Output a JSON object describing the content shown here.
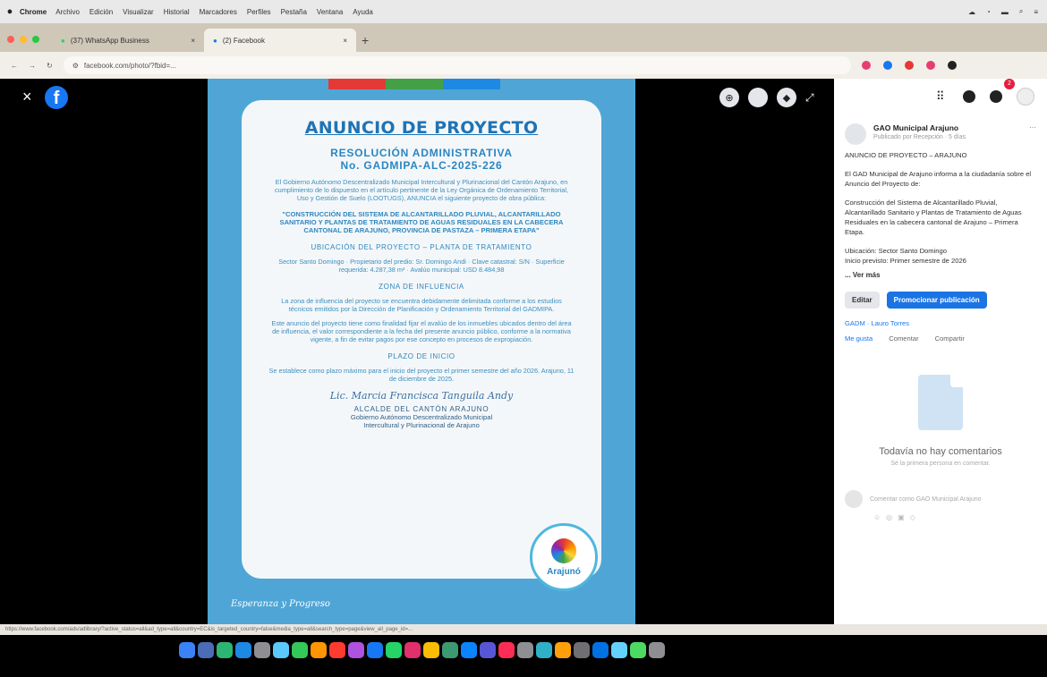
{
  "menubar": {
    "app": "Chrome",
    "items": [
      "Archivo",
      "Edición",
      "Visualizar",
      "Historial",
      "Marcadores",
      "Perfiles",
      "Pestaña",
      "Ventana",
      "Ayuda"
    ]
  },
  "tabs": [
    {
      "label": "(37) WhatsApp Business"
    },
    {
      "label": "(2) Facebook"
    }
  ],
  "address": {
    "url": "facebook.com/photo/?fbid=..."
  },
  "poster": {
    "title": "ANUNCIO DE PROYECTO",
    "resolution_line1": "RESOLUCIÓN ADMINISTRATIVA",
    "resolution_line2": "No. GADMIPA-ALC-2025-226",
    "intro": "El Gobierno Autónomo Descentralizado Municipal Intercultural y Plurinacional del Cantón Arajuno, en cumplimiento de lo dispuesto en el artículo pertinente de la Ley Orgánica de Ordenamiento Territorial, Uso y Gestión de Suelo (LOOTUGS), ANUNCIA el siguiente proyecto de obra pública:",
    "project": "\"CONSTRUCCIÓN DEL SISTEMA DE ALCANTARILLADO PLUVIAL, ALCANTARILLADO SANITARIO Y PLANTAS DE TRATAMIENTO DE AGUAS RESIDUALES EN LA CABECERA CANTONAL DE ARAJUNO, PROVINCIA DE PASTAZA – PRIMERA ETAPA\"",
    "ubicacion_title": "UBICACIÓN DEL PROYECTO – PLANTA DE TRATAMIENTO",
    "ubicacion_body": "Sector Santo Domingo · Propietario del predio: Sr. Domingo Andi · Clave catastral: S/N · Superficie requerida: 4.287,38 m² · Avalúo municipal: USD 8.484,98",
    "zona_title": "ZONA DE INFLUENCIA",
    "zona_body": "La zona de influencia del proyecto se encuentra debidamente delimitada conforme a los estudios técnicos emitidos por la Dirección de Planificación y Ordenamiento Territorial del GADMIPA.",
    "effects": "Este anuncio del proyecto tiene como finalidad fijar el avalúo de los inmuebles ubicados dentro del área de influencia, el valor correspondiente a la fecha del presente anuncio público, conforme a la normativa vigente, a fin de evitar pagos por ese concepto en procesos de expropiación.",
    "plazo_title": "PLAZO DE INICIO",
    "plazo_body": "Se establece como plazo máximo para el inicio del proyecto el primer semestre del año 2026. Arajuno, 11 de diciembre de 2025.",
    "signature": "Lic. Marcia Francisca Tanguila Andy",
    "alcalde": "ALCALDE DEL CANTÓN ARAJUNO",
    "gad_line1": "Gobierno Autónomo Descentralizado Municipal",
    "gad_line2": "Intercultural y Plurinacional de Arajuno",
    "seal_name": "Arajunó",
    "motto": "Esperanza y Progreso"
  },
  "post": {
    "author": "GAO Municipal Arajuno",
    "meta": "Publicado por Recepción · 5 días",
    "headline": "ANUNCIO DE PROYECTO – ARAJUNO",
    "p1": "El GAD Municipal de Arajuno informa a la ciudadanía sobre el Anuncio del Proyecto de:",
    "p2": "Construcción del Sistema de Alcantarillado Pluvial, Alcantarillado Sanitario y Plantas de Tratamiento de Aguas Residuales en la cabecera cantonal de Arajuno – Primera Etapa.",
    "p3": "Ubicación: Sector Santo Domingo",
    "p4": "Inicio previsto: Primer semestre de 2026",
    "see_more": "... Ver más",
    "edit": "Editar",
    "promote": "Promocionar publicación",
    "stats": "GADM · Lauro Torres",
    "like": "Me gusta",
    "comment": "Comentar",
    "share": "Compartir",
    "no_comments": "Todavía no hay comentarios",
    "no_comments_sub": "Sé la primera persona en comentar.",
    "comment_placeholder": "Comentar como GAO Municipal Arajuno"
  },
  "notifications_badge": "2",
  "status_url": "https://www.facebook.com/ads/adlibrary/?active_status=all&ad_type=all&country=EC&is_targeted_country=false&media_type=all&search_type=page&view_all_page_id=..."
}
